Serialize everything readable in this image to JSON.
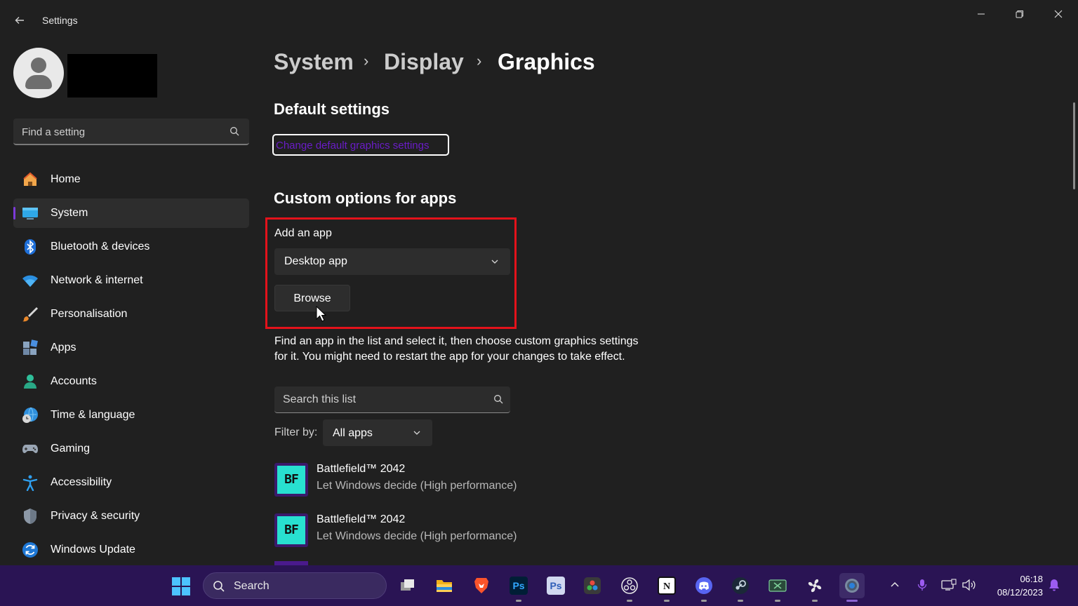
{
  "window": {
    "title": "Settings",
    "controls": {
      "minimize": "—",
      "maximize": "❐",
      "close": "✕"
    }
  },
  "sidebar": {
    "search_placeholder": "Find a setting",
    "items": [
      {
        "label": "Home",
        "icon": "home-icon",
        "active": false
      },
      {
        "label": "System",
        "icon": "system-icon",
        "active": true
      },
      {
        "label": "Bluetooth & devices",
        "icon": "bluetooth-icon",
        "active": false
      },
      {
        "label": "Network & internet",
        "icon": "wifi-icon",
        "active": false
      },
      {
        "label": "Personalisation",
        "icon": "brush-icon",
        "active": false
      },
      {
        "label": "Apps",
        "icon": "apps-icon",
        "active": false
      },
      {
        "label": "Accounts",
        "icon": "accounts-icon",
        "active": false
      },
      {
        "label": "Time & language",
        "icon": "globe-clock-icon",
        "active": false
      },
      {
        "label": "Gaming",
        "icon": "gamepad-icon",
        "active": false
      },
      {
        "label": "Accessibility",
        "icon": "accessibility-icon",
        "active": false
      },
      {
        "label": "Privacy & security",
        "icon": "shield-icon",
        "active": false
      },
      {
        "label": "Windows Update",
        "icon": "update-icon",
        "active": false
      }
    ]
  },
  "main": {
    "breadcrumb": [
      "System",
      "Display",
      "Graphics"
    ],
    "breadcrumb_separator": "›",
    "default_settings": {
      "heading": "Default settings",
      "link": "Change default graphics settings"
    },
    "custom_options": {
      "heading": "Custom options for apps",
      "add_app_label": "Add an app",
      "app_type": "Desktop app",
      "browse_label": "Browse",
      "help_text": "Find an app in the list and select it, then choose custom graphics settings for it. You might need to restart the app for your changes to take effect.",
      "list_search_placeholder": "Search this list",
      "filter_label": "Filter by:",
      "filter_value": "All apps",
      "apps": [
        {
          "name": "Battlefield™ 2042",
          "preference": "Let Windows decide (High performance)",
          "icon_text": "BF"
        },
        {
          "name": "Battlefield™ 2042",
          "preference": "Let Windows decide (High performance)",
          "icon_text": "BF"
        }
      ]
    }
  },
  "taskbar": {
    "search_label": "Search",
    "apps": [
      {
        "name": "task-view",
        "glyph": "",
        "color": "#d8d8d8"
      },
      {
        "name": "file-explorer",
        "glyph": "",
        "color": "#f2b21a"
      },
      {
        "name": "brave",
        "glyph": "",
        "color": "#fb542b"
      },
      {
        "name": "photoshop",
        "glyph": "Ps",
        "color": "#001e36"
      },
      {
        "name": "photoshop-2",
        "glyph": "Ps",
        "color": "#d0d8f0"
      },
      {
        "name": "davinci-resolve",
        "glyph": "",
        "color": "#444444"
      },
      {
        "name": "obs",
        "glyph": "",
        "color": "#2a1454"
      },
      {
        "name": "notion",
        "glyph": "N",
        "color": "#ffffff"
      },
      {
        "name": "discord",
        "glyph": "",
        "color": "#5865f2"
      },
      {
        "name": "steam",
        "glyph": "",
        "color": "#1b2838"
      },
      {
        "name": "xbox",
        "glyph": "✕",
        "color": "#2a4a3a"
      },
      {
        "name": "fan-app",
        "glyph": "✣",
        "color": "#2a1454"
      },
      {
        "name": "settings",
        "glyph": "⚙",
        "color": "#5a6a80"
      }
    ],
    "time": "06:18",
    "date": "08/12/2023"
  },
  "colors": {
    "background": "#202020",
    "accent": "#7c3ad8",
    "highlight_box": "#e3121b",
    "taskbar": "#2a1454",
    "link": "#6a1cc7"
  }
}
